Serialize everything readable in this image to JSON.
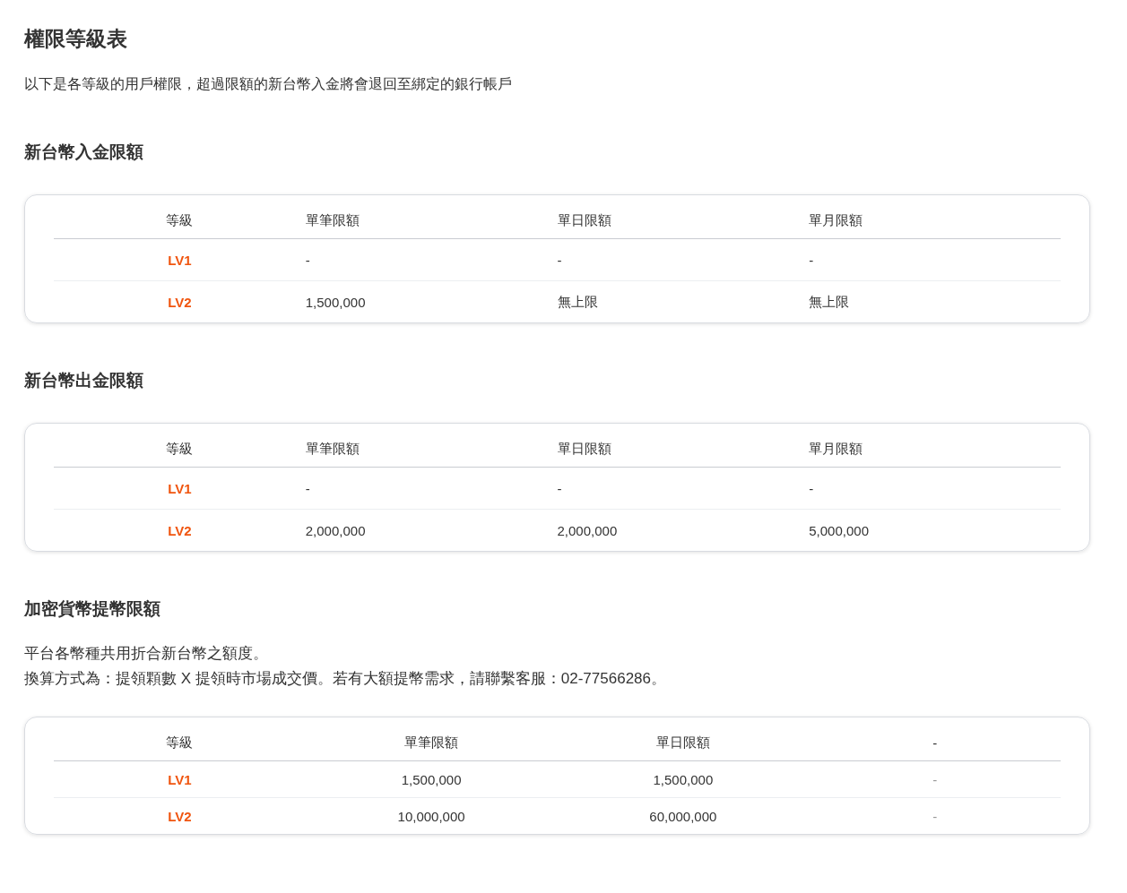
{
  "title": "權限等級表",
  "description": "以下是各等級的用戶權限，超過限額的新台幣入金將會退回至綁定的銀行帳戶",
  "sections": [
    {
      "heading": "新台幣入金限額",
      "table": {
        "kind": "limits",
        "columns": [
          "等級",
          "單筆限額",
          "單日限額",
          "單月限額"
        ],
        "rows": [
          [
            "LV1",
            "-",
            "-",
            "-"
          ],
          [
            "LV2",
            "1,500,000",
            "無上限",
            "無上限"
          ]
        ]
      }
    },
    {
      "heading": "新台幣出金限額",
      "table": {
        "kind": "limits",
        "columns": [
          "等級",
          "單筆限額",
          "單日限額",
          "單月限額"
        ],
        "rows": [
          [
            "LV1",
            "-",
            "-",
            "-"
          ],
          [
            "LV2",
            "2,000,000",
            "2,000,000",
            "5,000,000"
          ]
        ]
      }
    },
    {
      "heading": "加密貨幣提幣限額",
      "notes": [
        "平台各幣種共用折合新台幣之額度。",
        "換算方式為：提領顆數 X 提領時市場成交價。若有大額提幣需求，請聯繫客服：02-77566286。"
      ],
      "table": {
        "kind": "centered",
        "columns": [
          "等級",
          "單筆限額",
          "單日限額",
          "-"
        ],
        "rows": [
          [
            "LV1",
            "1,500,000",
            "1,500,000",
            "-"
          ],
          [
            "LV2",
            "10,000,000",
            "60,000,000",
            "-"
          ]
        ]
      }
    }
  ]
}
